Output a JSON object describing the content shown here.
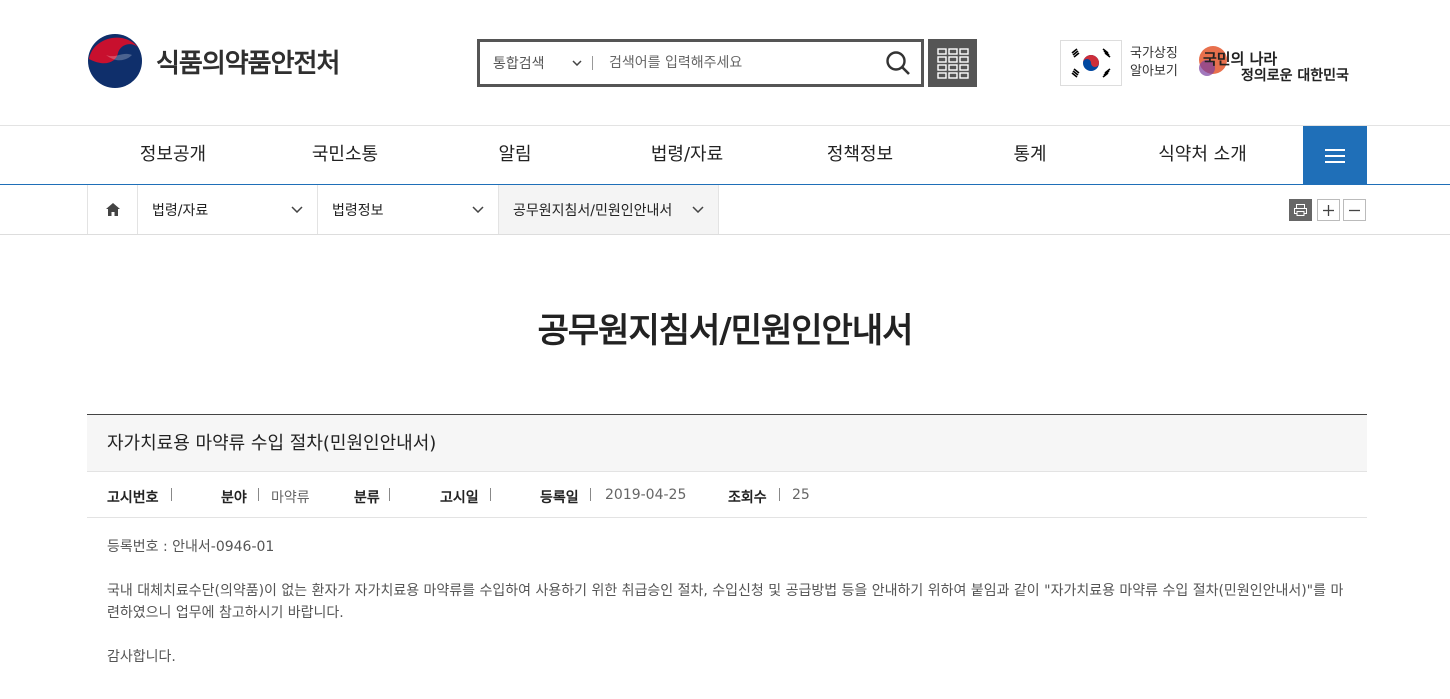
{
  "header": {
    "org_name": "식품의약품안전처",
    "search": {
      "scope": "통합검색",
      "placeholder": "검색어를 입력해주세요"
    },
    "symbol_text": "국가상징 알아보기",
    "slogan_line1": "국민의 나라",
    "slogan_line2": "정의로운 대한민국"
  },
  "gnb": {
    "items": [
      "정보공개",
      "국민소통",
      "알림",
      "법령/자료",
      "정책정보",
      "통계",
      "식약처 소개"
    ]
  },
  "location": {
    "items": [
      "법령/자료",
      "법령정보",
      "공무원지침서/민원인안내서"
    ]
  },
  "page": {
    "title": "공무원지침서/민원인안내서"
  },
  "board": {
    "title": "자가치료용 마약류 수입 절차(민원인안내서)",
    "info": {
      "notice_no_label": "고시번호",
      "notice_no": "",
      "field_label": "분야",
      "field": "마약류",
      "category_label": "분류",
      "category": "",
      "notice_date_label": "고시일",
      "notice_date": "",
      "reg_date_label": "등록일",
      "reg_date": "2019-04-25",
      "views_label": "조회수",
      "views": "25"
    },
    "body": {
      "reg_no": "등록번호 : 안내서-0946-01",
      "paragraph": "국내 대체치료수단(의약품)이 없는 환자가 자가치료용 마약류를 수입하여 사용하기 위한 취급승인 절차, 수입신청 및 공급방법 등을 안내하기 위하여 붙임과 같이 \"자가치료용 마약류 수입 절차(민원인안내서)\"를 마련하였으니 업무에 참고하시기 바랍니다.",
      "closing": "감사합니다."
    }
  },
  "colors": {
    "brand_blue": "#1f6fb8",
    "dark_gray": "#555555",
    "logo_red": "#c8102e",
    "logo_navy": "#0f2f6b"
  }
}
